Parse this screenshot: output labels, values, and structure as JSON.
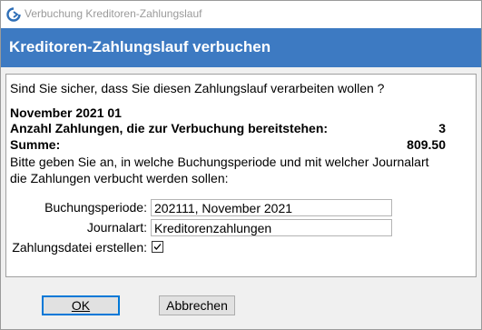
{
  "window": {
    "title": "Verbuchung Kreditoren-Zahlungslauf"
  },
  "header": {
    "title": "Kreditoren-Zahlungslauf verbuchen"
  },
  "content": {
    "question": "Sind Sie sicher, dass Sie diesen Zahlungslauf verarbeiten wollen ?",
    "period_heading": "November 2021 01",
    "payments_label": "Anzahl Zahlungen, die zur Verbuchung bereitstehen:",
    "payments_value": "3",
    "sum_label": "Summe:",
    "sum_value": "809.50",
    "instruction_line1": "Bitte geben Sie an, in welche Buchungsperiode und mit welcher Journalart",
    "instruction_line2": "die Zahlungen verbucht werden sollen:"
  },
  "form": {
    "period_label": "Buchungsperiode:",
    "period_value": "202111, November 2021",
    "journal_label": "Journalart:",
    "journal_value": "Kreditorenzahlungen",
    "file_label": "Zahlungsdatei erstellen:",
    "file_checked": true
  },
  "buttons": {
    "ok_label": "OK",
    "cancel_label": "Abbrechen"
  }
}
